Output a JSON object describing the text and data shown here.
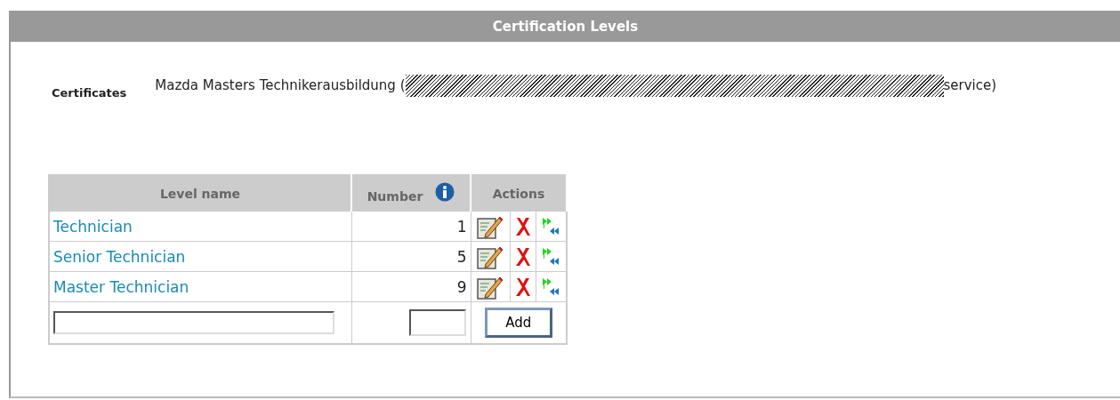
{
  "panel": {
    "title": "Certification Levels"
  },
  "certificates": {
    "label": "Certificates",
    "text_before": "Mazda Masters Technikerausbildung (",
    "redacted": true,
    "text_after": "service)"
  },
  "table": {
    "columns": [
      "Level name",
      "Number",
      "Actions"
    ],
    "rows": [
      {
        "name": "Technician",
        "number": "1"
      },
      {
        "name": "Senior Technician",
        "number": "5"
      },
      {
        "name": "Master Technician",
        "number": "9"
      }
    ],
    "add_button": "Add"
  }
}
